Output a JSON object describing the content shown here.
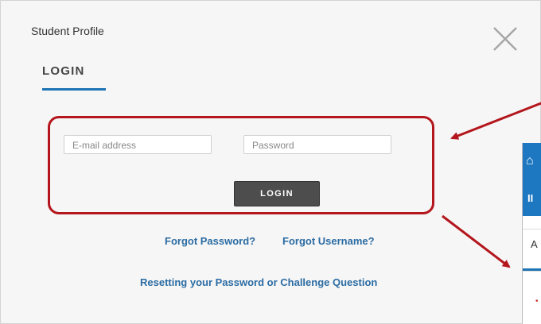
{
  "modal": {
    "title": "Student Profile",
    "tab_login": "LOGIN",
    "email_placeholder": "E-mail address",
    "password_placeholder": "Password",
    "login_button": "LOGIN",
    "forgot_password": "Forgot Password?",
    "forgot_username": "Forgot Username?",
    "reset_link": "Resetting your Password or Challenge Question"
  },
  "side_panel": {
    "header_text": "II",
    "tab_letter": "A"
  },
  "colors": {
    "accent_blue": "#1e73b4",
    "link_blue": "#2b6ca3",
    "highlight_red": "#b3161c",
    "button_dark": "#4d4d4d"
  },
  "icons": [
    "close-icon",
    "graduation-cap-icon"
  ]
}
